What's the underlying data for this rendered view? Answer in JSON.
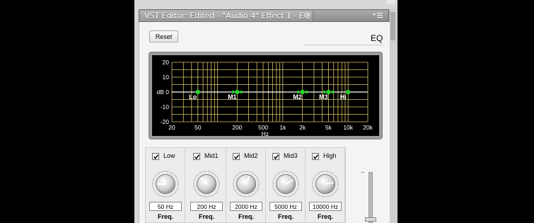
{
  "window": {
    "title": "VST Editor: Edited - \"Audio 4\" Effect 1 - EQ",
    "close_glyph": "×"
  },
  "toolbar": {
    "reset_label": "Reset",
    "eq_label": "EQ"
  },
  "graph": {
    "y_ticks": [
      "20",
      "10",
      "dB 0",
      "-10",
      "-20"
    ],
    "x_ticks": [
      "20",
      "50",
      "200",
      "500",
      "1k",
      "2k",
      "5k",
      "10k",
      "20k"
    ],
    "x_unit": "Hz",
    "band_markers": [
      "Lo",
      "M1",
      "M2",
      "M3",
      "Hi"
    ],
    "colors": {
      "background": "#000000",
      "grid": "#d8c56a",
      "node": "#27d227",
      "curve": "#ffffff",
      "label": "#ffffff"
    }
  },
  "chart_data": {
    "type": "line",
    "x_scale": "log",
    "xlim": [
      20,
      20000
    ],
    "ylim": [
      -20,
      20
    ],
    "x": [
      20,
      20000
    ],
    "series": [
      {
        "values": [
          0,
          0
        ]
      }
    ],
    "band_nodes": [
      {
        "label": "Lo",
        "x": 50,
        "y": 0
      },
      {
        "label": "M1",
        "x": 200,
        "y": 0
      },
      {
        "label": "M2",
        "x": 2000,
        "y": 0
      },
      {
        "label": "M3",
        "x": 5000,
        "y": 0
      },
      {
        "label": "Hi",
        "x": 10000,
        "y": 0
      }
    ],
    "grid": true
  },
  "bands": [
    {
      "name": "Low",
      "value": "50 Hz",
      "param": "Freq.",
      "enabled": true,
      "knob_angle": -90
    },
    {
      "name": "Mid1",
      "value": "200 Hz",
      "param": "Freq.",
      "enabled": true,
      "knob_angle": -45
    },
    {
      "name": "Mid2",
      "value": "2000 Hz",
      "param": "Freq.",
      "enabled": true,
      "knob_angle": 25
    },
    {
      "name": "Mid3",
      "value": "5000 Hz",
      "param": "Freq.",
      "enabled": true,
      "knob_angle": 60
    },
    {
      "name": "High",
      "value": "10000 Hz",
      "param": "Freq.",
      "enabled": true,
      "knob_angle": 80
    }
  ]
}
